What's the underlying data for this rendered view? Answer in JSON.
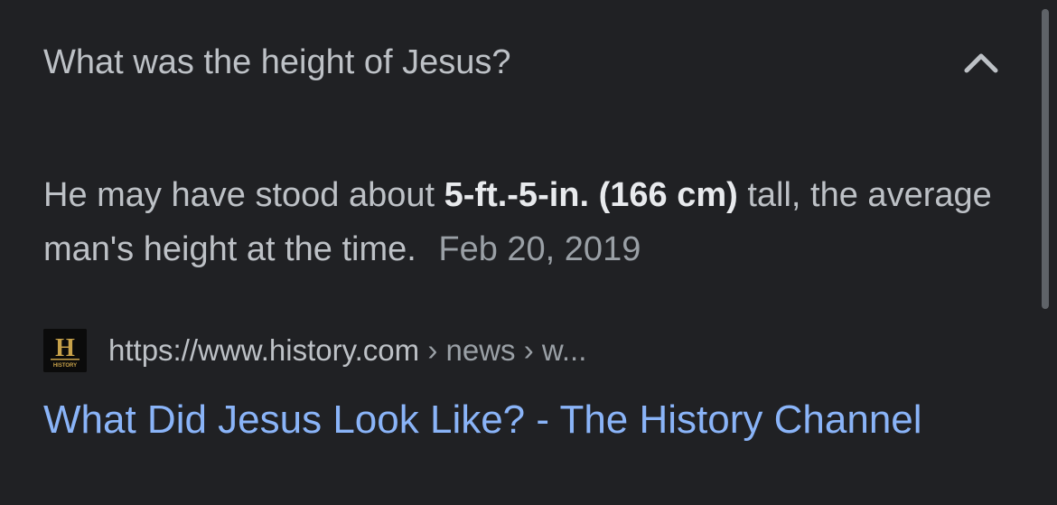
{
  "question": {
    "text": "What was the height of Jesus?",
    "expand_icon": "chevron-up-icon"
  },
  "answer": {
    "prefix": "He may have stood about",
    "highlight": "5-ft.-5-in. (166 cm)",
    "suffix": "tall, the average man's height at the time.",
    "date": "Feb 20, 2019"
  },
  "source": {
    "favicon_letter": "H",
    "favicon_label": "HISTORY",
    "favicon_color": "#c8a24a",
    "url_base": "https://www.history.com",
    "url_crumbs": "› news › w..."
  },
  "result": {
    "title": "What Did Jesus Look Like? - The History Channel"
  },
  "colors": {
    "background": "#202124",
    "text": "#bdc1c6",
    "bold_text": "#e8eaed",
    "muted": "#9aa0a6",
    "link": "#8ab4f8"
  }
}
